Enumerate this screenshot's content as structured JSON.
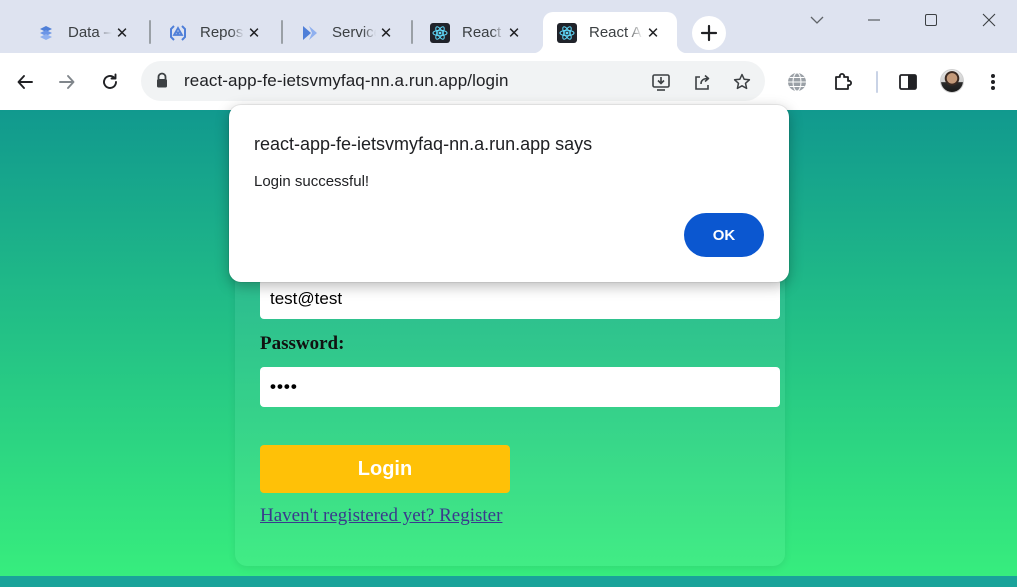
{
  "tabs": [
    {
      "title": "Data – Cloud Firestore",
      "icon": "firestore-icon"
    },
    {
      "title": "Repositories – Artifact Registry",
      "icon": "artifact-registry-icon"
    },
    {
      "title": "Services – Cloud Run",
      "icon": "cloud-run-icon"
    },
    {
      "title": "React App",
      "icon": "react-icon"
    },
    {
      "title": "React App",
      "icon": "react-icon",
      "active": true
    }
  ],
  "toolbar": {
    "url": "react-app-fe-ietsvmyfaq-nn.a.run.app/login"
  },
  "form": {
    "email_value": "test@test",
    "password_label": "Password:",
    "password_value": "••••",
    "login_label": "Login",
    "register_link": "Haven't registered yet? Register"
  },
  "dialog": {
    "title": "react-app-fe-ietsvmyfaq-nn.a.run.app says",
    "message": "Login successful!",
    "ok_label": "OK"
  },
  "colors": {
    "gradient_top": "#11998e",
    "gradient_bottom": "#38ef7d",
    "login_button": "#ffc107",
    "dialog_button": "#0b57d0",
    "tabstrip": "#dee3f0"
  }
}
